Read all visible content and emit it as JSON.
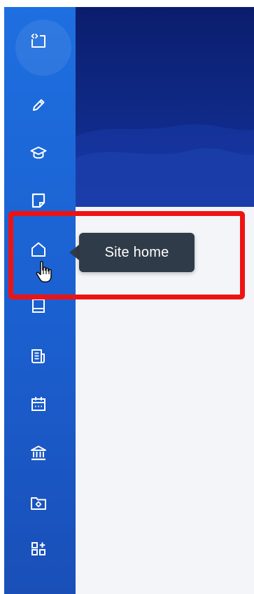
{
  "tooltip": {
    "text": "Site home"
  },
  "sidebar": {
    "items": [
      {
        "name": "toggle-sidebar",
        "icon": "toggle-sidebar-icon"
      },
      {
        "name": "edit",
        "icon": "pencil-icon"
      },
      {
        "name": "courses",
        "icon": "graduation-cap-icon"
      },
      {
        "name": "notes",
        "icon": "sticky-note-icon"
      },
      {
        "name": "site-home",
        "icon": "home-icon"
      },
      {
        "name": "book",
        "icon": "book-icon"
      },
      {
        "name": "news",
        "icon": "newspaper-icon"
      },
      {
        "name": "calendar",
        "icon": "calendar-icon"
      },
      {
        "name": "institution",
        "icon": "bank-icon"
      },
      {
        "name": "files",
        "icon": "folder-settings-icon"
      },
      {
        "name": "add-block",
        "icon": "add-block-icon"
      }
    ]
  },
  "colors": {
    "sidebar": "#1b5fcf",
    "hero": "#0f2a87",
    "tooltip": "#2f3b48",
    "highlight": "#ee1313",
    "content": "#f4f5f8"
  }
}
